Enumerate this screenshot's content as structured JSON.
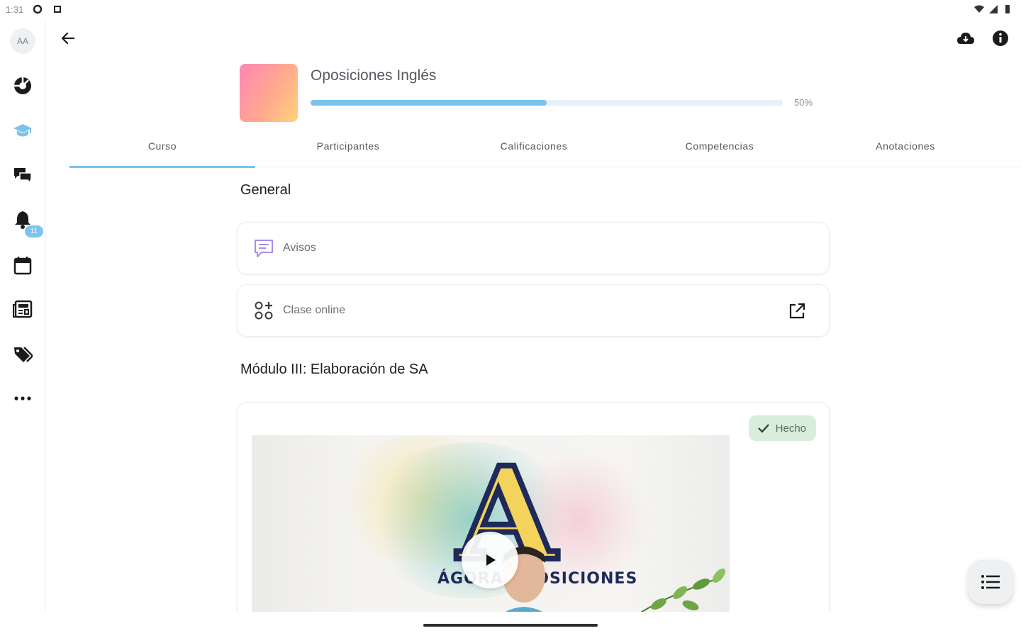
{
  "status_bar": {
    "time": "1:31"
  },
  "rail": {
    "avatar_initials": "AA",
    "items": [
      {
        "icon": "dashboard-icon"
      },
      {
        "icon": "courses-icon"
      },
      {
        "icon": "messages-icon"
      },
      {
        "icon": "notifications-icon",
        "badge": "11"
      },
      {
        "icon": "calendar-icon"
      },
      {
        "icon": "news-icon"
      },
      {
        "icon": "tags-icon"
      },
      {
        "icon": "more-icon"
      }
    ]
  },
  "course": {
    "title": "Oposiciones Inglés",
    "progress": 50,
    "progress_label": "50%"
  },
  "tabs": [
    {
      "label": "Curso",
      "active": true
    },
    {
      "label": "Participantes",
      "active": false
    },
    {
      "label": "Calificaciones",
      "active": false
    },
    {
      "label": "Competencias",
      "active": false
    },
    {
      "label": "Anotaciones",
      "active": false
    }
  ],
  "sections": {
    "general": {
      "title": "General",
      "items": [
        {
          "label": "Avisos",
          "icon": "forum-icon"
        },
        {
          "label": "Clase online",
          "icon": "online-class-icon",
          "end_icon": "open-external-icon"
        }
      ]
    },
    "module": {
      "title": "Módulo III: Elaboración de SA",
      "done_label": "Hecho",
      "video_logo_letter": "A",
      "video_logo_word": "ÁGORA OPOSICIONES"
    }
  },
  "colors": {
    "accent": "#7cc3ee",
    "done_chip": "#d8eddb",
    "thumb_gradient": [
      "#ff86b4",
      "#ffa98e",
      "#ffd27a"
    ]
  }
}
